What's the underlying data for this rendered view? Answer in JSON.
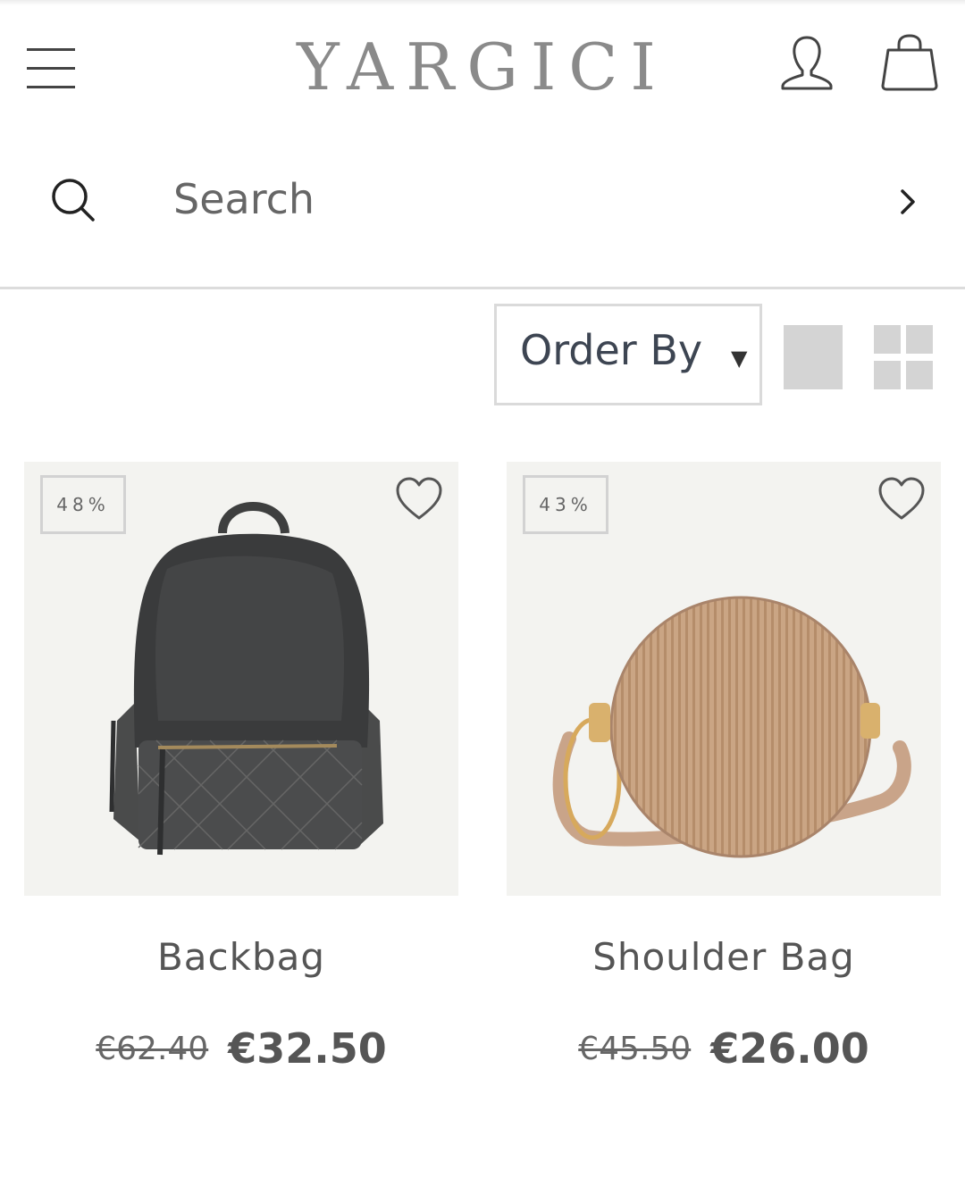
{
  "header": {
    "logo_text": "YARGICI",
    "menu_icon": "hamburger-menu-icon",
    "account_icon": "user-icon",
    "cart_icon": "shopping-bag-icon"
  },
  "search": {
    "placeholder": "Search",
    "value": "",
    "icon": "search-icon",
    "submit_icon": "chevron-right-icon"
  },
  "toolbar": {
    "order_by_label": "Order By",
    "order_by_caret": "▼",
    "view_modes": [
      "single-column-view-icon",
      "two-column-grid-icon"
    ]
  },
  "products": [
    {
      "discount": "48%",
      "title": "Backbag",
      "old_price": "€62.40",
      "new_price": "€32.50",
      "wishlist_icon": "heart-icon"
    },
    {
      "discount": "43%",
      "title": "Shoulder Bag",
      "old_price": "€45.50",
      "new_price": "€26.00",
      "wishlist_icon": "heart-icon"
    }
  ],
  "colors": {
    "text": "#555555",
    "logo": "#8a8a8a",
    "divider": "#dcdcdc",
    "image_bg": "#f3f3f0",
    "view_toggle": "#d4d4d4"
  }
}
